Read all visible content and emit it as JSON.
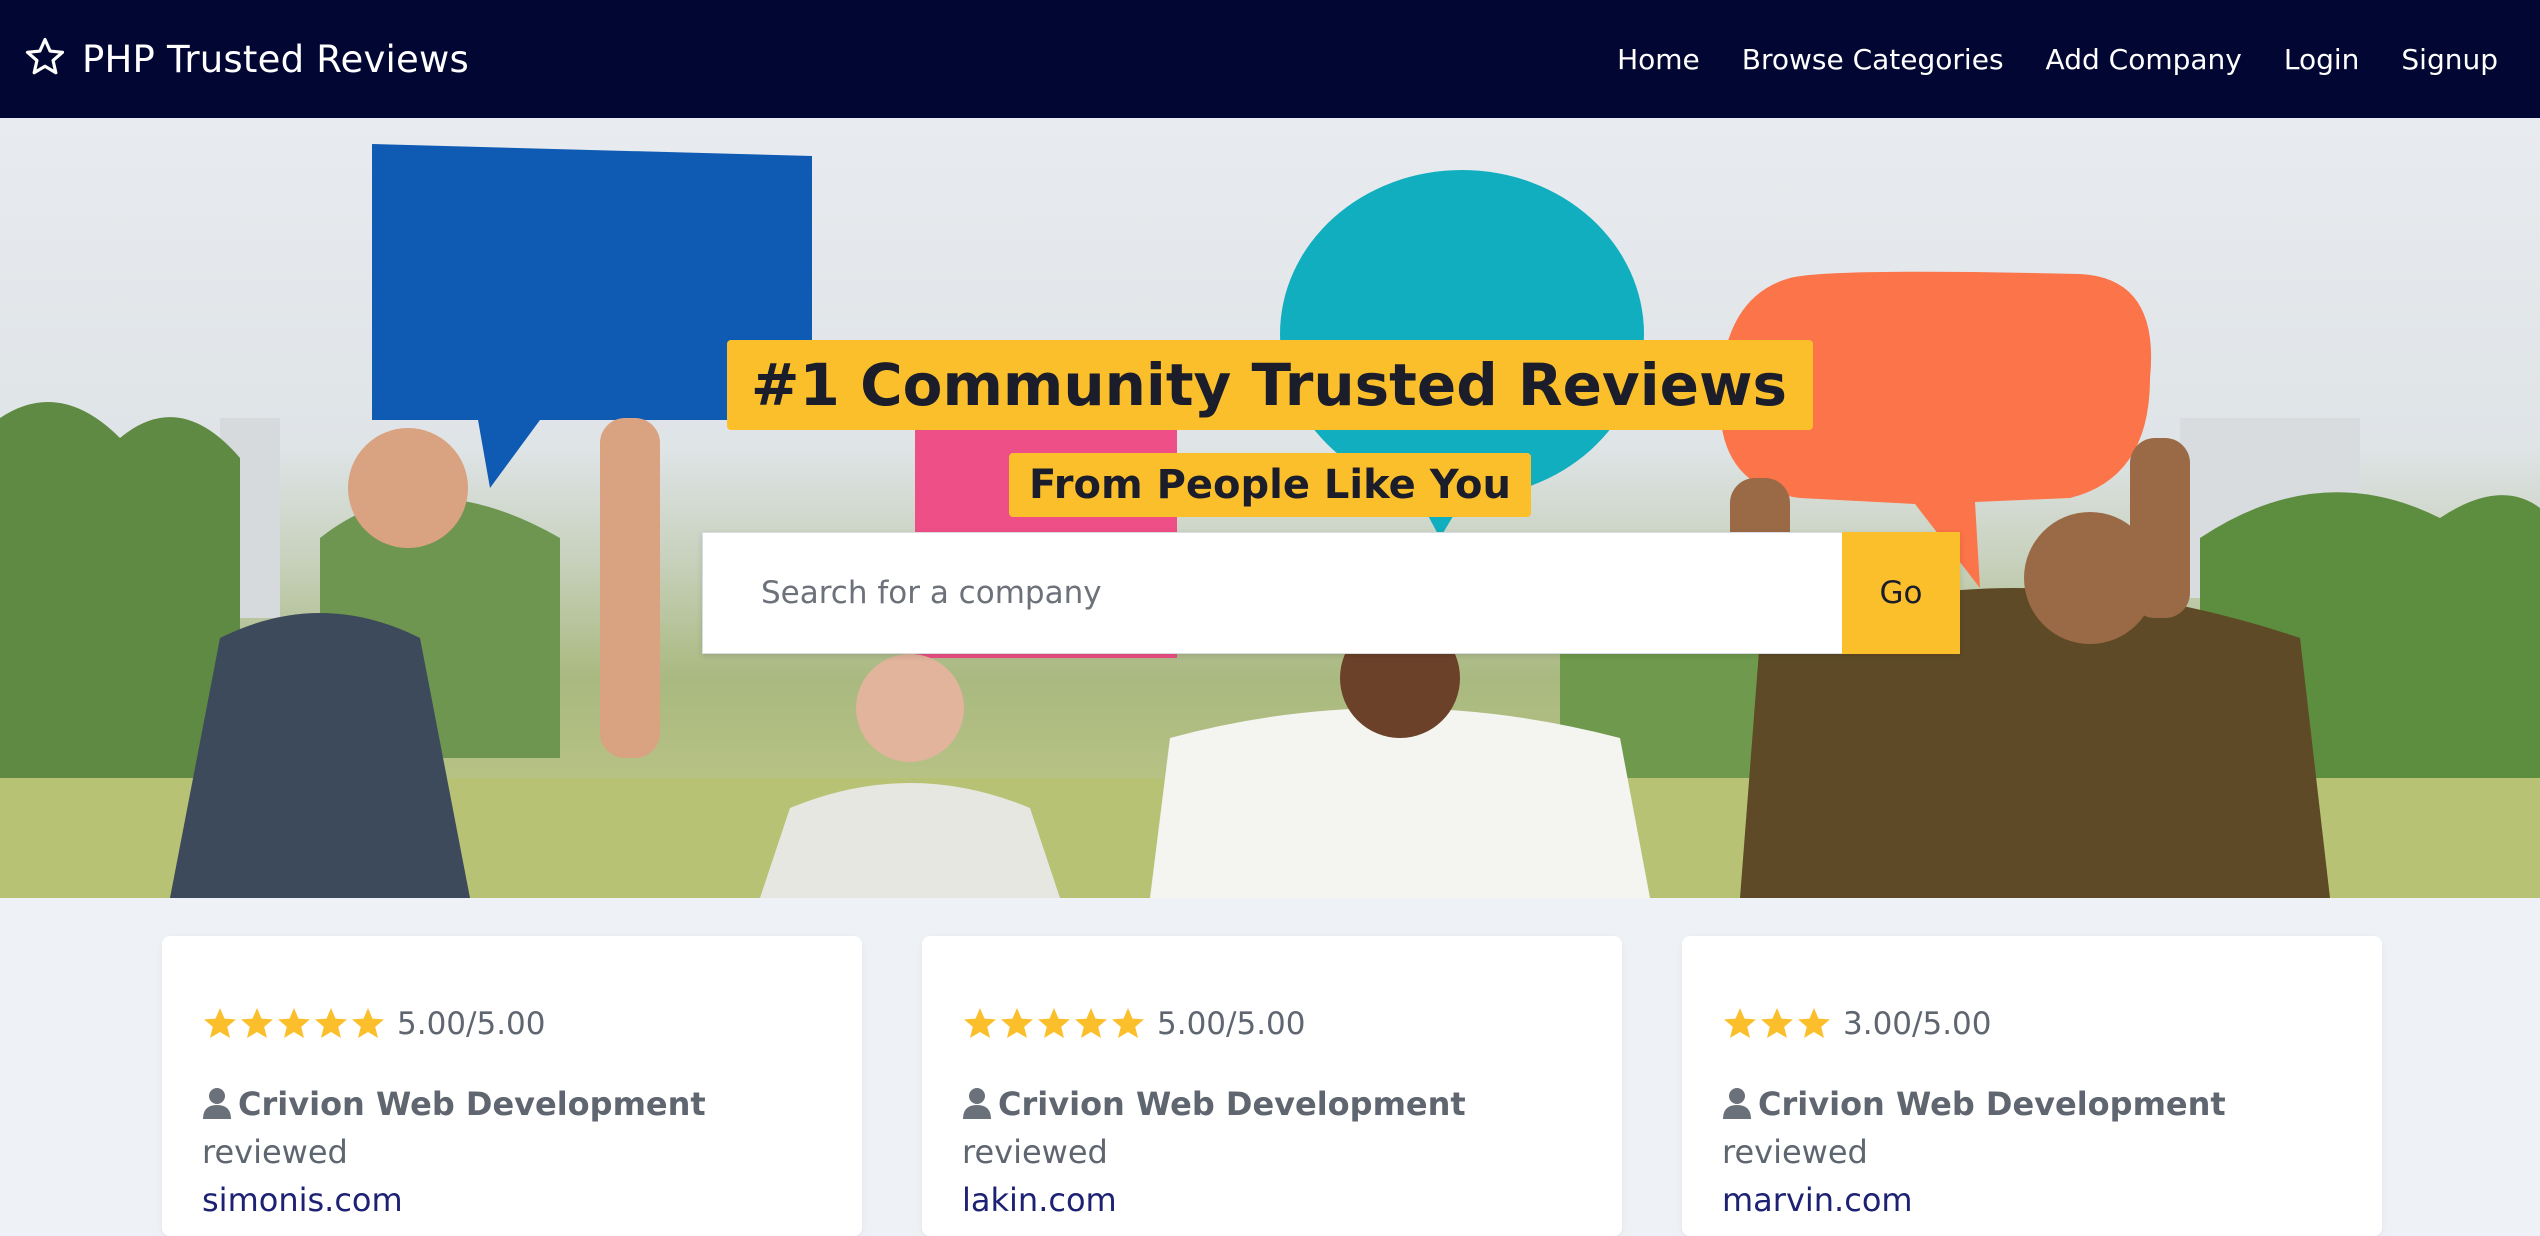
{
  "navbar": {
    "brand_icon": "star-outline-icon",
    "brand": "PHP Trusted Reviews",
    "links": [
      "Home",
      "Browse Categories",
      "Add Company",
      "Login",
      "Signup"
    ]
  },
  "hero": {
    "headline": "#1 Community Trusted Reviews",
    "subheadline": "From People Like You",
    "search_placeholder": "Search for a company",
    "search_button": "Go"
  },
  "reviews": [
    {
      "stars": 5,
      "rating": "5.00/5.00",
      "reviewer": "Crivion Web Development",
      "action": "reviewed",
      "company": "simonis.com"
    },
    {
      "stars": 5,
      "rating": "5.00/5.00",
      "reviewer": "Crivion Web Development",
      "action": "reviewed",
      "company": "lakin.com"
    },
    {
      "stars": 3,
      "rating": "3.00/5.00",
      "reviewer": "Crivion Web Development",
      "action": "reviewed",
      "company": "marvin.com"
    }
  ],
  "colors": {
    "navbar_bg": "#020632",
    "accent": "#fbbf2b",
    "link": "#1c2173",
    "text_muted": "#5f6670"
  }
}
